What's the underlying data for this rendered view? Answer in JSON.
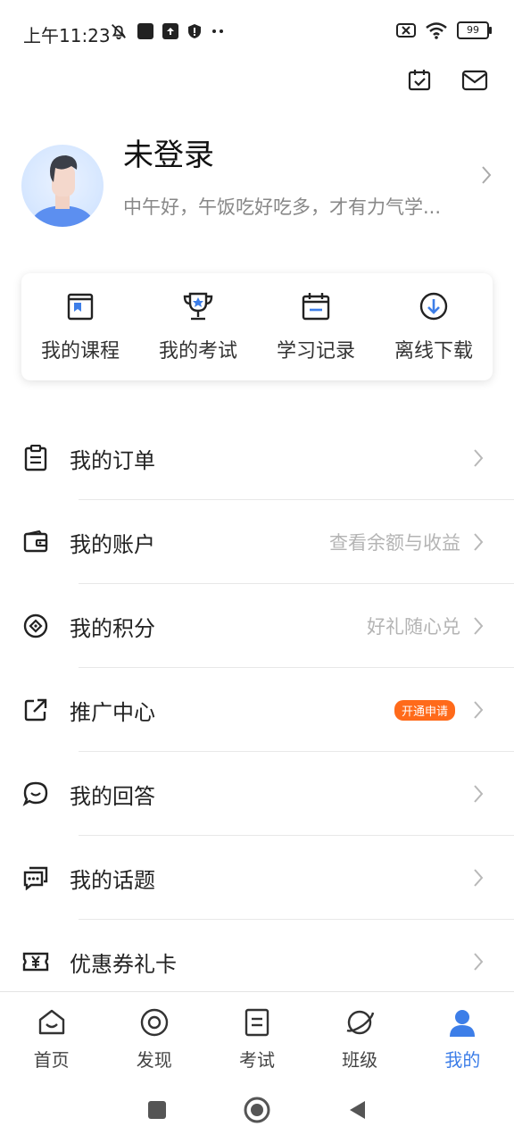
{
  "status_bar": {
    "time": "上午11:23",
    "battery": "99"
  },
  "top_actions": {
    "checkin_icon": "calendar-check-icon",
    "message_icon": "mail-icon"
  },
  "profile": {
    "name": "未登录",
    "greeting": "中午好，午饭吃好吃多，才有力气学..."
  },
  "quick_actions": [
    {
      "label": "我的课程",
      "icon": "course-book-icon"
    },
    {
      "label": "我的考试",
      "icon": "trophy-icon"
    },
    {
      "label": "学习记录",
      "icon": "calendar-record-icon"
    },
    {
      "label": "离线下载",
      "icon": "download-icon"
    }
  ],
  "menu": [
    {
      "label": "我的订单",
      "hint": "",
      "badge": "",
      "icon": "clipboard-icon"
    },
    {
      "label": "我的账户",
      "hint": "查看余额与收益",
      "badge": "",
      "icon": "wallet-icon"
    },
    {
      "label": "我的积分",
      "hint": "好礼随心兑",
      "badge": "",
      "icon": "points-icon"
    },
    {
      "label": "推广中心",
      "hint": "",
      "badge": "开通申请",
      "icon": "share-icon"
    },
    {
      "label": "我的回答",
      "hint": "",
      "badge": "",
      "icon": "chat-bubble-icon"
    },
    {
      "label": "我的话题",
      "hint": "",
      "badge": "",
      "icon": "topic-icon"
    },
    {
      "label": "优惠券礼卡",
      "hint": "",
      "badge": "",
      "icon": "coupon-icon"
    }
  ],
  "tabs": [
    {
      "label": "首页",
      "icon": "home-icon",
      "active": false
    },
    {
      "label": "发现",
      "icon": "discover-icon",
      "active": false
    },
    {
      "label": "考试",
      "icon": "exam-icon",
      "active": false
    },
    {
      "label": "班级",
      "icon": "planet-icon",
      "active": false
    },
    {
      "label": "我的",
      "icon": "user-icon",
      "active": true
    }
  ],
  "colors": {
    "accent": "#3d7ee8",
    "badge": "#ff6a1a",
    "hint": "#b4b4b4"
  }
}
